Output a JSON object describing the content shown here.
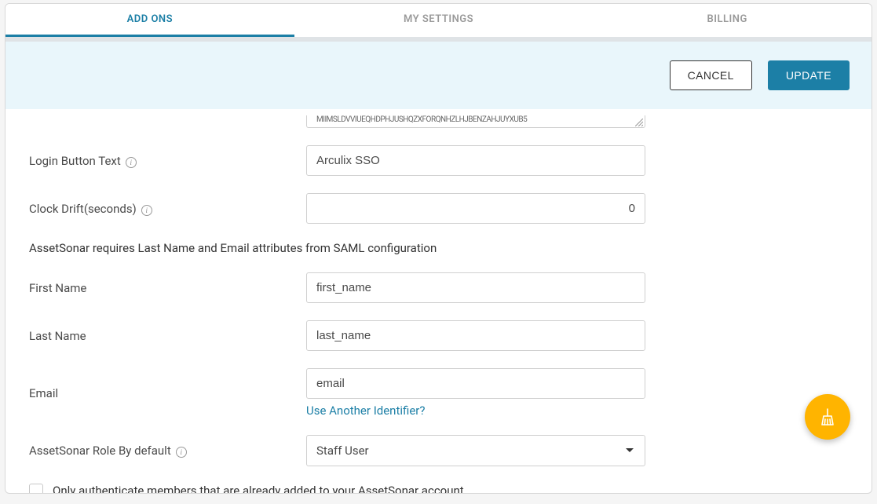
{
  "tabs": {
    "addons": "ADD ONS",
    "settings": "MY SETTINGS",
    "billing": "BILLING"
  },
  "actions": {
    "cancel": "CANCEL",
    "update": "UPDATE"
  },
  "form": {
    "truncated_cert": "MIIMSLDVVIUEQHDPHJUSHQZXFORQNHZLHJBENZAHJUYXUB5",
    "login_button_text": {
      "label": "Login Button Text",
      "value": "Arculix SSO"
    },
    "clock_drift": {
      "label": "Clock Drift(seconds)",
      "value": "0"
    },
    "attr_note": "AssetSonar requires Last Name and Email attributes from SAML configuration",
    "first_name": {
      "label": "First Name",
      "value": "first_name"
    },
    "last_name": {
      "label": "Last Name",
      "value": "last_name"
    },
    "email": {
      "label": "Email",
      "value": "email",
      "link": "Use Another Identifier?"
    },
    "role": {
      "label": "AssetSonar Role By default",
      "selected": "Staff User"
    },
    "only_members": {
      "label": "Only authenticate members that are already added to your AssetSonar account."
    }
  }
}
